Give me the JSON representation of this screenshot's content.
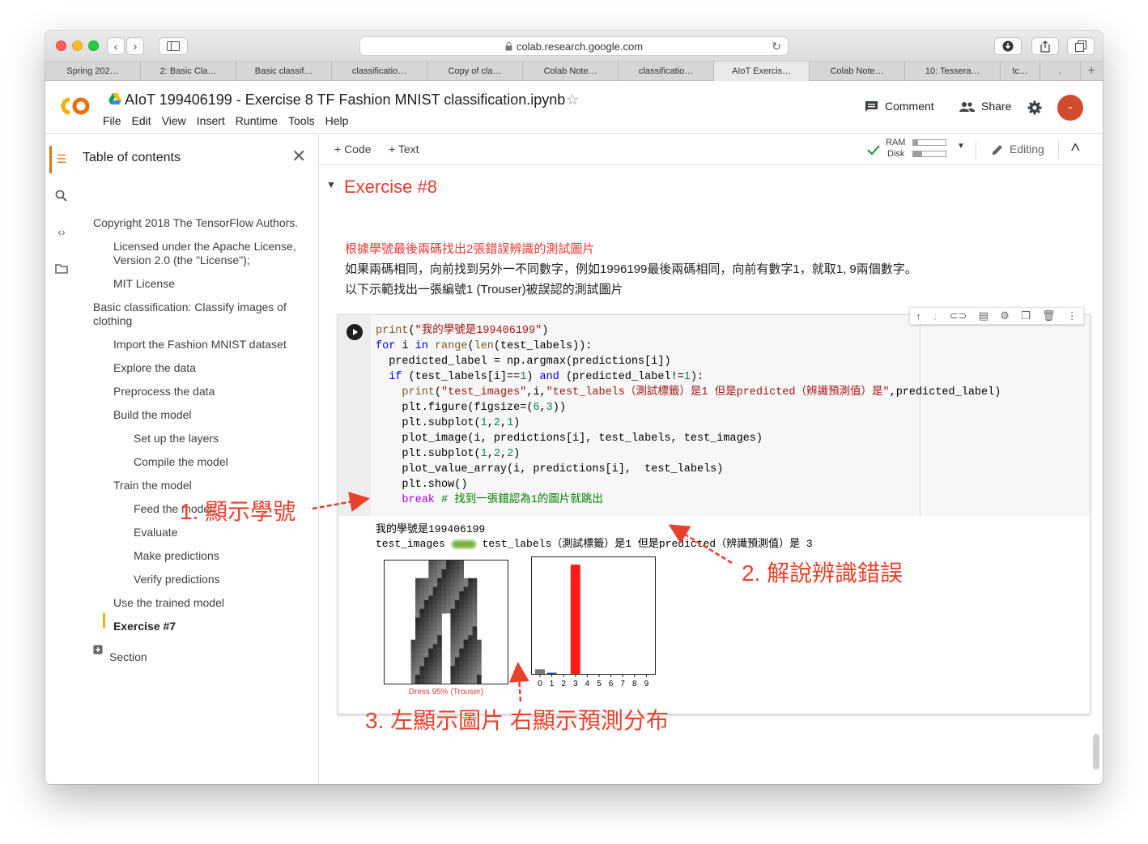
{
  "browser": {
    "url": "colab.research.google.com",
    "tabs": [
      "Spring 202…",
      "2: Basic Cla…",
      "Basic classif…",
      "classificatio…",
      "Copy of cla…",
      "Colab Note…",
      "classificatio…",
      "AIoT Exercis…",
      "Colab Note…",
      "10: Tessera…",
      "tc…",
      "."
    ],
    "new_tab": "+"
  },
  "colab": {
    "title": "AIoT 199406199 - Exercise 8 TF Fashion MNIST classification.ipynb",
    "menu": [
      "File",
      "Edit",
      "View",
      "Insert",
      "Runtime",
      "Tools",
      "Help"
    ],
    "comment": "Comment",
    "share": "Share",
    "avatar": "-"
  },
  "toc": {
    "title": "Table of contents",
    "items": [
      "Copyright 2018 The TensorFlow Authors.",
      "Licensed under the Apache License, Version 2.0 (the \"License\");",
      "MIT License",
      "Basic classification: Classify images of clothing",
      "Import the Fashion MNIST dataset",
      "Explore the data",
      "Preprocess the data",
      "Build the model",
      "Set up the layers",
      "Compile the model",
      "Train the model",
      "Feed the model",
      "Evaluate",
      "Make predictions",
      "Verify predictions",
      "Use the trained model",
      "Exercise #7",
      "Section"
    ]
  },
  "toolbar": {
    "code": "+ Code",
    "text": "+ Text",
    "ram": "RAM",
    "disk": "Disk",
    "editing": "Editing"
  },
  "section": {
    "title": "Exercise #8",
    "lines": [
      "根據學號最後兩碼找出2張錯誤辨識的測試圖片",
      "如果兩碼相同，向前找到另外一不同數字，例如1996199最後兩碼相同，向前有數字1，就取1, 9兩個數字。",
      "以下示範找出一張編號1 (Trouser)被誤認的測試圖片"
    ]
  },
  "output": {
    "line1": "我的學號是199406199",
    "line2_a": "test_images",
    "line2_b": "test_labels（測試標籤）是1 但是predicted（辨識預測值）是 3",
    "image_caption": "Dress 95% (Trouser)",
    "bar_ticks": [
      "0",
      "1",
      "2",
      "3",
      "4",
      "5",
      "6",
      "7",
      "8",
      "9"
    ]
  },
  "chart_data": {
    "type": "bar",
    "categories": [
      "0",
      "1",
      "2",
      "3",
      "4",
      "5",
      "6",
      "7",
      "8",
      "9"
    ],
    "values": [
      0.04,
      0.01,
      0,
      0.95,
      0,
      0,
      0,
      0,
      0,
      0
    ],
    "bar_colors": [
      "#777777",
      "#1f3fbf",
      "#777777",
      "#ff1a1a",
      "#777777",
      "#777777",
      "#777777",
      "#777777",
      "#777777",
      "#777777"
    ],
    "ylim": [
      0,
      1
    ],
    "grid": false
  },
  "annotations": {
    "a1": "1. 顯示學號",
    "a2": "2. 解說辨識錯誤",
    "a3": "3. 左顯示圖片 右顯示預測分布"
  },
  "colors": {
    "accent": "#e53935",
    "annotation": "#e8412c",
    "colab_orange": "#f9ab00"
  }
}
